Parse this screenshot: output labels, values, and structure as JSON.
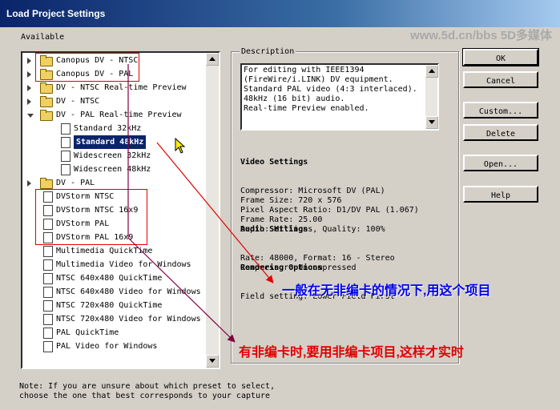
{
  "window": {
    "title": "Load Project Settings"
  },
  "watermark": "www.5d.cn/bbs 5D多媒体",
  "available_label": "Available",
  "tree_items": [
    {
      "label": "Canopus DV - NTSC",
      "type": "folder",
      "level": 0
    },
    {
      "label": "Canopus DV - PAL",
      "type": "folder",
      "level": 0
    },
    {
      "label": "DV - NTSC Real-time Preview",
      "type": "folder",
      "level": 0
    },
    {
      "label": "DV - NTSC",
      "type": "folder",
      "level": 0
    },
    {
      "label": "DV - PAL Real-time Preview",
      "type": "folder-open",
      "level": 0
    },
    {
      "label": "Standard 32kHz",
      "type": "doc",
      "level": 1
    },
    {
      "label": "Standard 48kHz",
      "type": "doc",
      "level": 1,
      "selected": true
    },
    {
      "label": "Widescreen 32kHz",
      "type": "doc",
      "level": 1
    },
    {
      "label": "Widescreen 48kHz",
      "type": "doc",
      "level": 1
    },
    {
      "label": "DV - PAL",
      "type": "folder",
      "level": 0
    },
    {
      "label": "DVStorm NTSC",
      "type": "doc",
      "level": 0
    },
    {
      "label": "DVStorm NTSC 16x9",
      "type": "doc",
      "level": 0
    },
    {
      "label": "DVStorm PAL",
      "type": "doc",
      "level": 0
    },
    {
      "label": "DVStorm PAL 16x9",
      "type": "doc",
      "level": 0
    },
    {
      "label": "Multimedia QuickTime",
      "type": "doc",
      "level": 0
    },
    {
      "label": "Multimedia Video for Windows",
      "type": "doc",
      "level": 0
    },
    {
      "label": "NTSC 640x480 QuickTime",
      "type": "doc",
      "level": 0
    },
    {
      "label": "NTSC 640x480 Video for Windows",
      "type": "doc",
      "level": 0
    },
    {
      "label": "NTSC 720x480 QuickTime",
      "type": "doc",
      "level": 0
    },
    {
      "label": "NTSC 720x480 Video for Windows",
      "type": "doc",
      "level": 0
    },
    {
      "label": "PAL QuickTime",
      "type": "doc",
      "level": 0
    },
    {
      "label": "PAL Video for Windows",
      "type": "doc",
      "level": 0
    }
  ],
  "description": {
    "legend": "Description",
    "text": "For editing with IEEE1394\n(FireWire/i.LINK) DV equipment.\nStandard PAL video (4:3 interlaced).\n48kHz (16 bit) audio.\nReal-time Preview enabled."
  },
  "video_settings": {
    "heading": "Video Settings",
    "lines": "Compressor: Microsoft DV (PAL)\nFrame Size: 720 x 576\nPixel Aspect Ratio: D1/DV PAL (1.067)\nFrame Rate: 25.00\nDepth: Millions, Quality: 100%"
  },
  "audio_settings": {
    "heading": "Audio Settings",
    "lines": "Rate: 48000, Format: 16 - Stereo\nCompressor: Uncompressed"
  },
  "rendering_options": {
    "heading": "Rendering Options",
    "lines": "Field setting: Lower Field First"
  },
  "buttons": {
    "ok": "OK",
    "cancel": "Cancel",
    "custom": "Custom...",
    "delete": "Delete",
    "open": "Open...",
    "help": "Help"
  },
  "note": "Note: If you are unsure about which preset to select,\nchoose the one that best corresponds to your capture",
  "annotations": {
    "blue": "一般在无非编卡的情况下,用这个项目",
    "red": "有非编卡时,要用非编卡项目,这样才实时"
  },
  "colors": {
    "title_bar": "#0a246a",
    "selection": "#0a246a",
    "annotation_blue": "#0000ee",
    "annotation_red": "#e00000",
    "arrow_dark": "#800040"
  }
}
